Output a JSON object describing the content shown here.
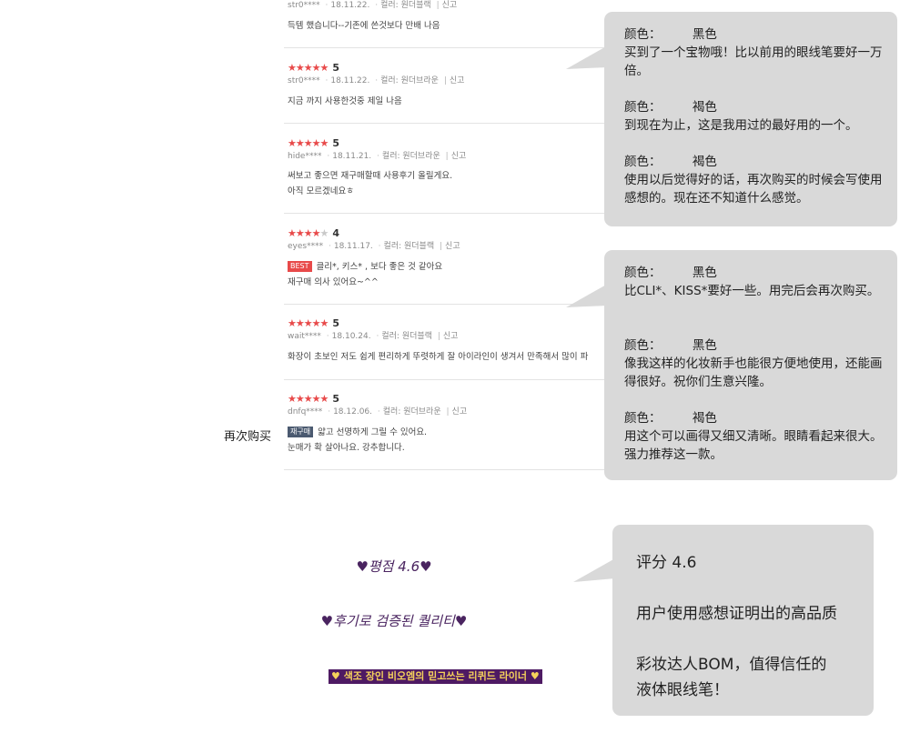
{
  "reviews": [
    {
      "author": "str0****",
      "date": "18.11.22.",
      "color": "컬러: 원더블랙",
      "report": "신고",
      "text": [
        "득템 했습니다--기존에 쓴것보다 만배 나음"
      ]
    },
    {
      "stars": "★★★★★",
      "score": "5",
      "author": "str0****",
      "date": "18.11.22.",
      "color": "컬러: 원더브라운",
      "report": "신고",
      "text": [
        "지금 까지 사용한것중 제일 나음"
      ]
    },
    {
      "stars": "★★★★★",
      "score": "5",
      "author": "hide****",
      "date": "18.11.21.",
      "color": "컬러: 원더브라운",
      "report": "신고",
      "text": [
        "써보고 좋으면 재구매할때 사용후기 올릴게요.",
        "아직 모르겠네요ㅎ"
      ]
    },
    {
      "stars_on": "★★★★",
      "stars_off": "★",
      "score": "4",
      "author": "eyes****",
      "date": "18.11.17.",
      "color": "컬러: 원더블랙",
      "report": "신고",
      "badge": "BEST",
      "text": [
        "클리*, 키스* , 보다 좋은 것 같아요",
        "재구매 의사 있어요~^^"
      ]
    },
    {
      "stars": "★★★★★",
      "score": "5",
      "author": "wait****",
      "date": "18.10.24.",
      "color": "컬러: 원더블랙",
      "report": "신고",
      "text": [
        "화장이 초보인 저도 쉽게 편리하게 뚜렷하게 잘 아이라인이 생겨서 만족해서 많이 파"
      ]
    },
    {
      "stars": "★★★★★",
      "score": "5",
      "author": "dnfq****",
      "date": "18.12.06.",
      "color": "컬러: 원더브라운",
      "report": "신고",
      "badge": "재구매",
      "text": [
        "얇고 선명하게 그릴 수 있어요.",
        "눈매가 확 살아나요. 강추합니다."
      ]
    }
  ],
  "side_label": "再次购买",
  "bubble1": [
    {
      "color_label": "颜色：",
      "color_value": "黑色",
      "text": "买到了一个宝物哦！比以前用的眼线笔要好一万倍。"
    },
    {
      "color_label": "颜色：",
      "color_value": "褐色",
      "text": "到现在为止，这是我用过的最好用的一个。"
    },
    {
      "color_label": "颜色：",
      "color_value": "褐色",
      "text": "使用以后觉得好的话，再次购买的时候会写使用感想的。现在还不知道什么感觉。"
    }
  ],
  "bubble2": [
    {
      "color_label": "颜色：",
      "color_value": "黑色",
      "text": "比CLI*、KISS*要好一些。用完后会再次购买。"
    },
    {
      "color_label": "颜色：",
      "color_value": "黑色",
      "text": "像我这样的化妆新手也能很方便地使用，还能画得很好。祝你们生意兴隆。"
    },
    {
      "color_label": "颜色：",
      "color_value": "褐色",
      "text": "用这个可以画得又细又清晰。眼睛看起来很大。强力推荐这一款。"
    }
  ],
  "bubble3": {
    "line1": "评分 4.6",
    "line2": "用户使用感想证明出的高品质",
    "line3a": "彩妆达人BOM，值得信任的",
    "line3b": "液体眼线笔！"
  },
  "promo": {
    "rating": "♥평점 4.6♥",
    "quality": "♥후기로 검증된 퀄리티♥",
    "banner": "♥ 색조 장인 비오엠의 믿고쓰는 리퀴드 라이너 ♥"
  },
  "colors": {
    "star": "#e84a4a",
    "bubble": "#d9d9d9",
    "promo_text": "#4a2460",
    "banner_bg": "#4e1a63",
    "banner_text": "#f5d25b"
  }
}
